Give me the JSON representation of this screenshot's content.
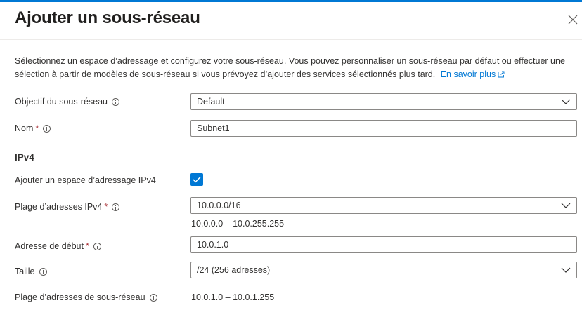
{
  "panel": {
    "title": "Ajouter un sous-réseau",
    "description": "Sélectionnez un espace d’adressage et configurez votre sous-réseau. Vous pouvez personnaliser un sous-réseau par défaut ou effectuer une sélection à partir de modèles de sous-réseau si vous prévoyez d’ajouter des services sélectionnés plus tard.",
    "learn_more": "En savoir plus"
  },
  "form": {
    "purpose": {
      "label": "Objectif du sous-réseau",
      "value": "Default"
    },
    "name": {
      "label": "Nom",
      "required_mark": "*",
      "value": "Subnet1"
    },
    "ipv4_section": "IPv4",
    "add_ipv4": {
      "label": "Ajouter un espace d’adressage IPv4",
      "checked": true
    },
    "ipv4_range": {
      "label": "Plage d’adresses IPv4",
      "required_mark": "*",
      "value": "10.0.0.0/16",
      "range_text": "10.0.0.0 – 10.0.255.255"
    },
    "start_address": {
      "label": "Adresse de début",
      "required_mark": "*",
      "value": "10.0.1.0"
    },
    "size": {
      "label": "Taille",
      "value": "/24 (256 adresses)"
    },
    "subnet_range": {
      "label": "Plage d’adresses de sous-réseau",
      "value": "10.0.1.0 – 10.0.1.255"
    }
  },
  "colors": {
    "accent": "#0078d4",
    "border": "#8a8886",
    "required": "#a4262c"
  },
  "icons": [
    "close-icon",
    "external-link-icon",
    "info-icon",
    "chevron-down-icon",
    "checkmark-icon"
  ]
}
